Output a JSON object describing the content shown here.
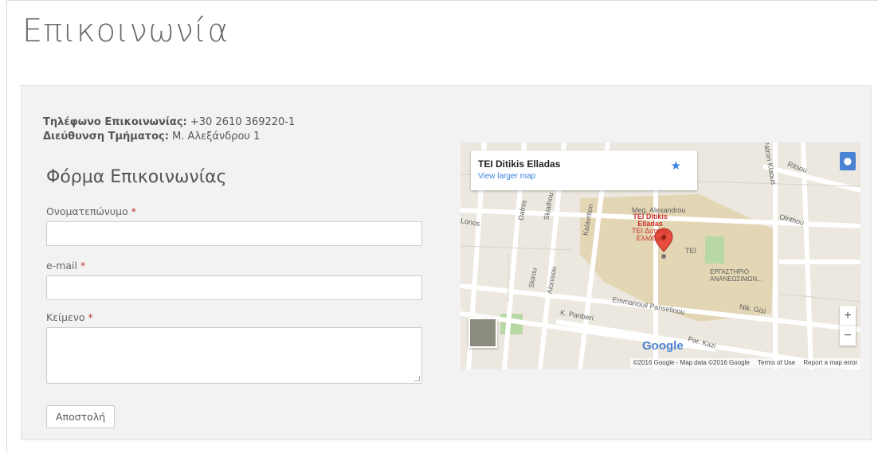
{
  "page": {
    "title": "Επικοινωνία"
  },
  "contact": {
    "phone_label": "Τηλέφωνο Επικοινωνίας:",
    "phone_value": "+30 2610 369220-1",
    "address_label": "Διεύθυνση Τμήματος:",
    "address_value": "Μ. Αλεξάνδρου 1"
  },
  "form": {
    "title": "Φόρμα Επικοινωνίας",
    "name_label": "Ονοματεπώνυμο",
    "email_label": "e-mail",
    "message_label": "Κείμενο",
    "required_marker": "*",
    "submit_label": "Αποστολή"
  },
  "map": {
    "place_name": "TEI Ditikis Elladas",
    "view_larger": "View larger map",
    "star_icon": "star-icon",
    "poi_label_1": "TEI Ditikis",
    "poi_label_2": "Elladas",
    "poi_label_3": "ΤΕΙ Δυτικής",
    "poi_label_4": "Ελλάδας",
    "lab_label_1": "ΕΡΓΑΣΤΗΡΙΟ",
    "lab_label_2": "ΑΝΑΝΕΩΣΙΜΩΝ...",
    "tei_label": "ΤΕΙ",
    "streets": {
      "s1": "Meg. Alexandrou",
      "s2": "Olnthou",
      "s3": "Kalavriton",
      "s4": "Skirou",
      "s5": "Alonisou",
      "s6": "Emmanouil Panselinou",
      "s7": "K. Panberi",
      "s8": "Nik. Gizi",
      "s9": "Par. Kazi",
      "s10": "Patron Klaous",
      "s11": "Dafnis",
      "s12": "Skiathou",
      "s13": "Ritsou",
      "s14": "Lonos"
    },
    "google_logo": "Google",
    "attribution": "©2016 Google - Map data ©2016 Google",
    "terms": "Terms of Use",
    "report": "Report a map error",
    "zoom_in": "+",
    "zoom_out": "−"
  }
}
